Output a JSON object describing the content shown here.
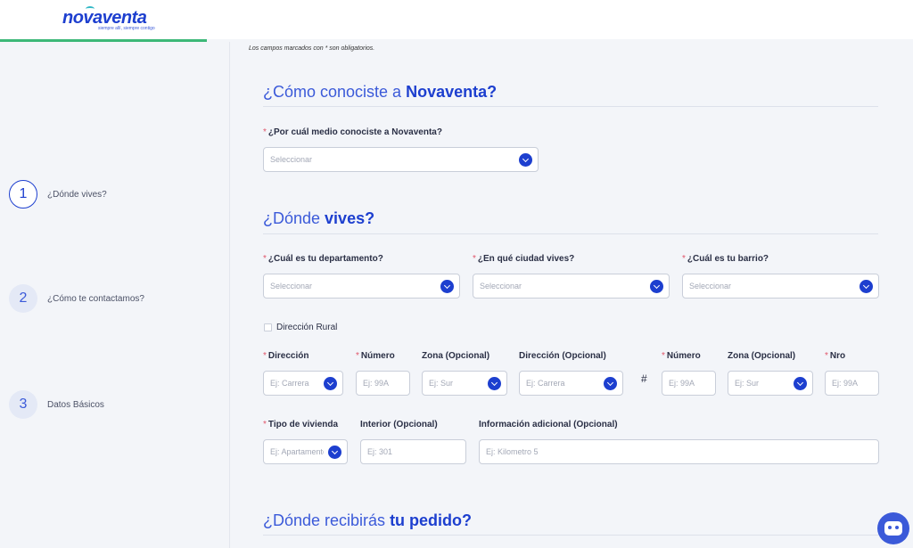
{
  "brand": {
    "name": "Novaventa",
    "logo_text": "novaventa",
    "tagline": "siempre allí, siempre contigo",
    "primary": "#1d3fcf",
    "accent": "#3b5ad9",
    "progress_color": "#3cb878",
    "required_color": "#e0566b"
  },
  "progress": {
    "fraction": 0.23
  },
  "steps": [
    {
      "number": "1",
      "label": "¿Dónde vives?",
      "active": true
    },
    {
      "number": "2",
      "label": "¿Cómo te contactamos?",
      "active": false
    },
    {
      "number": "3",
      "label": "Datos Básicos",
      "active": false
    }
  ],
  "required_note": "Los campos marcados con * son obligatorios.",
  "sections": {
    "how_known": {
      "title_light": "¿Cómo conociste a ",
      "title_bold": "Novaventa?"
    },
    "where_live": {
      "title_light": "¿Dónde ",
      "title_bold": "vives?"
    },
    "receive": {
      "title_light": "¿Dónde recibirás ",
      "title_bold": "tu pedido?"
    }
  },
  "fields": {
    "medio": {
      "label": "¿Por cuál medio conociste a Novaventa?",
      "placeholder": "Seleccionar"
    },
    "departamento": {
      "label": "¿Cuál es tu departamento?",
      "placeholder": "Seleccionar"
    },
    "ciudad": {
      "label": "¿En qué ciudad vives?",
      "placeholder": "Seleccionar"
    },
    "barrio": {
      "label": "¿Cuál es tu barrio?",
      "placeholder": "Seleccionar"
    },
    "rural": {
      "label": "Dirección Rural"
    },
    "direccion": {
      "label": "Dirección",
      "placeholder": "Ej: Carrera"
    },
    "numero": {
      "label": "Número",
      "placeholder": "Ej: 99A"
    },
    "zona": {
      "label": "Zona (Opcional)",
      "placeholder": "Ej: Sur"
    },
    "direccion_opc": {
      "label": "Dirección (Opcional)",
      "placeholder": "Ej: Carrera"
    },
    "hash": "#",
    "numero2": {
      "label": "Número",
      "placeholder": "Ej: 99A"
    },
    "zona2": {
      "label": "Zona (Opcional)",
      "placeholder": "Ej: Sur"
    },
    "nro": {
      "label": "Nro",
      "placeholder": "Ej: 99A"
    },
    "tipo_vivienda": {
      "label": "Tipo de vivienda",
      "placeholder": "Ej: Apartamento"
    },
    "interior": {
      "label": "Interior (Opcional)",
      "placeholder": "Ej: 301"
    },
    "info_adicional": {
      "label": "Información adicional (Opcional)",
      "placeholder": "Ej: Kilometro 5"
    }
  },
  "icons": {
    "chatbot": "robot-icon",
    "dropdown": "chevron-down-icon"
  }
}
